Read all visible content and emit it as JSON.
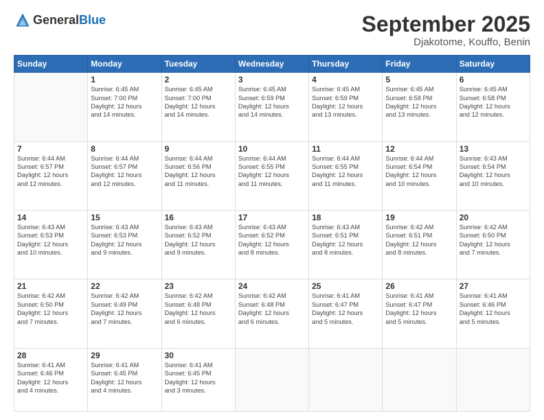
{
  "logo": {
    "general": "General",
    "blue": "Blue"
  },
  "title": "September 2025",
  "subtitle": "Djakotome, Kouffo, Benin",
  "days_of_week": [
    "Sunday",
    "Monday",
    "Tuesday",
    "Wednesday",
    "Thursday",
    "Friday",
    "Saturday"
  ],
  "weeks": [
    [
      {
        "day": "",
        "text": ""
      },
      {
        "day": "1",
        "text": "Sunrise: 6:45 AM\nSunset: 7:00 PM\nDaylight: 12 hours\nand 14 minutes."
      },
      {
        "day": "2",
        "text": "Sunrise: 6:45 AM\nSunset: 7:00 PM\nDaylight: 12 hours\nand 14 minutes."
      },
      {
        "day": "3",
        "text": "Sunrise: 6:45 AM\nSunset: 6:59 PM\nDaylight: 12 hours\nand 14 minutes."
      },
      {
        "day": "4",
        "text": "Sunrise: 6:45 AM\nSunset: 6:59 PM\nDaylight: 12 hours\nand 13 minutes."
      },
      {
        "day": "5",
        "text": "Sunrise: 6:45 AM\nSunset: 6:58 PM\nDaylight: 12 hours\nand 13 minutes."
      },
      {
        "day": "6",
        "text": "Sunrise: 6:45 AM\nSunset: 6:58 PM\nDaylight: 12 hours\nand 12 minutes."
      }
    ],
    [
      {
        "day": "7",
        "text": "Sunrise: 6:44 AM\nSunset: 6:57 PM\nDaylight: 12 hours\nand 12 minutes."
      },
      {
        "day": "8",
        "text": "Sunrise: 6:44 AM\nSunset: 6:57 PM\nDaylight: 12 hours\nand 12 minutes."
      },
      {
        "day": "9",
        "text": "Sunrise: 6:44 AM\nSunset: 6:56 PM\nDaylight: 12 hours\nand 11 minutes."
      },
      {
        "day": "10",
        "text": "Sunrise: 6:44 AM\nSunset: 6:55 PM\nDaylight: 12 hours\nand 11 minutes."
      },
      {
        "day": "11",
        "text": "Sunrise: 6:44 AM\nSunset: 6:55 PM\nDaylight: 12 hours\nand 11 minutes."
      },
      {
        "day": "12",
        "text": "Sunrise: 6:44 AM\nSunset: 6:54 PM\nDaylight: 12 hours\nand 10 minutes."
      },
      {
        "day": "13",
        "text": "Sunrise: 6:43 AM\nSunset: 6:54 PM\nDaylight: 12 hours\nand 10 minutes."
      }
    ],
    [
      {
        "day": "14",
        "text": "Sunrise: 6:43 AM\nSunset: 6:53 PM\nDaylight: 12 hours\nand 10 minutes."
      },
      {
        "day": "15",
        "text": "Sunrise: 6:43 AM\nSunset: 6:53 PM\nDaylight: 12 hours\nand 9 minutes."
      },
      {
        "day": "16",
        "text": "Sunrise: 6:43 AM\nSunset: 6:52 PM\nDaylight: 12 hours\nand 9 minutes."
      },
      {
        "day": "17",
        "text": "Sunrise: 6:43 AM\nSunset: 6:52 PM\nDaylight: 12 hours\nand 8 minutes."
      },
      {
        "day": "18",
        "text": "Sunrise: 6:43 AM\nSunset: 6:51 PM\nDaylight: 12 hours\nand 8 minutes."
      },
      {
        "day": "19",
        "text": "Sunrise: 6:42 AM\nSunset: 6:51 PM\nDaylight: 12 hours\nand 8 minutes."
      },
      {
        "day": "20",
        "text": "Sunrise: 6:42 AM\nSunset: 6:50 PM\nDaylight: 12 hours\nand 7 minutes."
      }
    ],
    [
      {
        "day": "21",
        "text": "Sunrise: 6:42 AM\nSunset: 6:50 PM\nDaylight: 12 hours\nand 7 minutes."
      },
      {
        "day": "22",
        "text": "Sunrise: 6:42 AM\nSunset: 6:49 PM\nDaylight: 12 hours\nand 7 minutes."
      },
      {
        "day": "23",
        "text": "Sunrise: 6:42 AM\nSunset: 6:48 PM\nDaylight: 12 hours\nand 6 minutes."
      },
      {
        "day": "24",
        "text": "Sunrise: 6:42 AM\nSunset: 6:48 PM\nDaylight: 12 hours\nand 6 minutes."
      },
      {
        "day": "25",
        "text": "Sunrise: 6:41 AM\nSunset: 6:47 PM\nDaylight: 12 hours\nand 5 minutes."
      },
      {
        "day": "26",
        "text": "Sunrise: 6:41 AM\nSunset: 6:47 PM\nDaylight: 12 hours\nand 5 minutes."
      },
      {
        "day": "27",
        "text": "Sunrise: 6:41 AM\nSunset: 6:46 PM\nDaylight: 12 hours\nand 5 minutes."
      }
    ],
    [
      {
        "day": "28",
        "text": "Sunrise: 6:41 AM\nSunset: 6:46 PM\nDaylight: 12 hours\nand 4 minutes."
      },
      {
        "day": "29",
        "text": "Sunrise: 6:41 AM\nSunset: 6:45 PM\nDaylight: 12 hours\nand 4 minutes."
      },
      {
        "day": "30",
        "text": "Sunrise: 6:41 AM\nSunset: 6:45 PM\nDaylight: 12 hours\nand 3 minutes."
      },
      {
        "day": "",
        "text": ""
      },
      {
        "day": "",
        "text": ""
      },
      {
        "day": "",
        "text": ""
      },
      {
        "day": "",
        "text": ""
      }
    ]
  ]
}
